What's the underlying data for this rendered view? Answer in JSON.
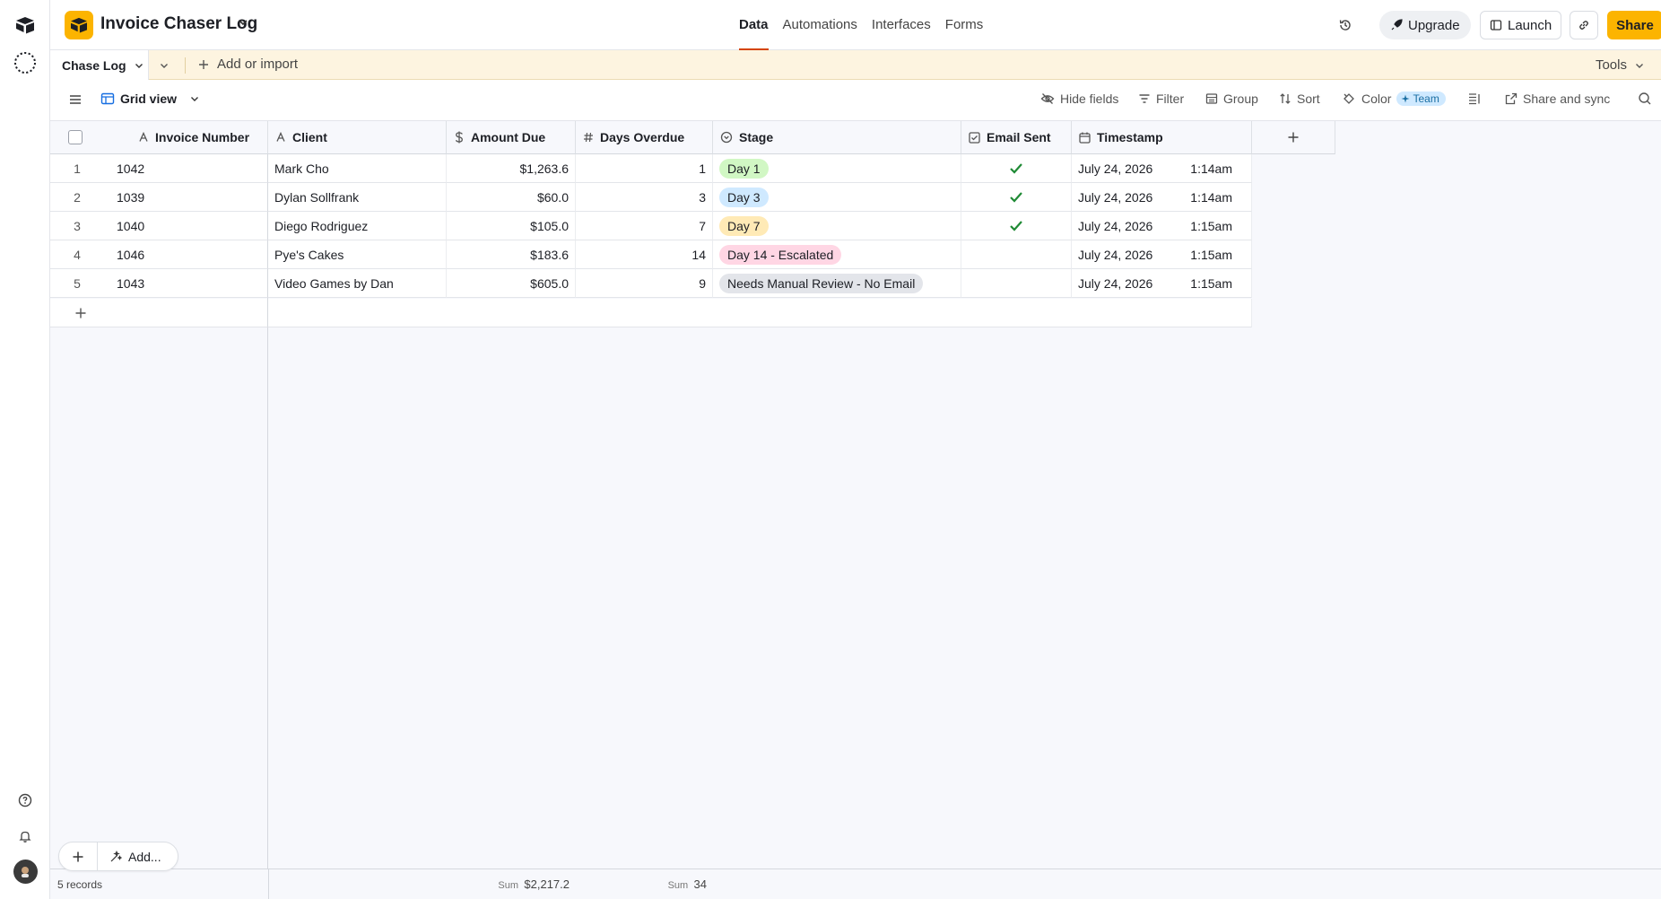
{
  "base": {
    "title": "Invoice Chaser Log"
  },
  "nav": {
    "tabs": [
      "Data",
      "Automations",
      "Interfaces",
      "Forms"
    ],
    "active": "Data"
  },
  "topbar": {
    "upgrade_label": "Upgrade",
    "launch_label": "Launch",
    "share_label": "Share"
  },
  "tables": {
    "active_tab": "Chase Log",
    "add_import_label": "Add or import",
    "tools_label": "Tools"
  },
  "viewbar": {
    "view_name": "Grid view",
    "hide_fields": "Hide fields",
    "filter": "Filter",
    "group": "Group",
    "sort": "Sort",
    "color": "Color",
    "color_badge": "Team",
    "share_sync": "Share and sync"
  },
  "columns": [
    "Invoice Number",
    "Client",
    "Amount Due",
    "Days Overdue",
    "Stage",
    "Email Sent",
    "Timestamp"
  ],
  "rows": [
    {
      "n": "1",
      "invoice": "1042",
      "client": "Mark Cho",
      "amount": "$1,263.6",
      "days": "1",
      "stage": "Day 1",
      "stage_color": "#d1f7c4",
      "email_sent": true,
      "date": "July 24, 2026",
      "time": "1:14am"
    },
    {
      "n": "2",
      "invoice": "1039",
      "client": "Dylan Sollfrank",
      "amount": "$60.0",
      "days": "3",
      "stage": "Day 3",
      "stage_color": "#cfe9ff",
      "email_sent": true,
      "date": "July 24, 2026",
      "time": "1:14am"
    },
    {
      "n": "3",
      "invoice": "1040",
      "client": "Diego Rodriguez",
      "amount": "$105.0",
      "days": "7",
      "stage": "Day 7",
      "stage_color": "#ffeab6",
      "email_sent": true,
      "date": "July 24, 2026",
      "time": "1:15am"
    },
    {
      "n": "4",
      "invoice": "1046",
      "client": "Pye's Cakes",
      "amount": "$183.6",
      "days": "14",
      "stage": "Day 14 - Escalated",
      "stage_color": "#ffd6e4",
      "email_sent": false,
      "date": "July 24, 2026",
      "time": "1:15am"
    },
    {
      "n": "5",
      "invoice": "1043",
      "client": "Video Games by Dan",
      "amount": "$605.0",
      "days": "9",
      "stage": "Needs Manual Review - No Email",
      "stage_color": "#e3e5ea",
      "email_sent": false,
      "date": "July 24, 2026",
      "time": "1:15am"
    }
  ],
  "footer": {
    "records": "5 records",
    "sum_label": "Sum",
    "amount_sum": "$2,217.2",
    "days_sum": "34"
  },
  "add_bar": {
    "label": "Add..."
  },
  "colors": {
    "accent": "#fcb400",
    "active_tab_underline": "#d54401",
    "check": "#1f8a35"
  }
}
